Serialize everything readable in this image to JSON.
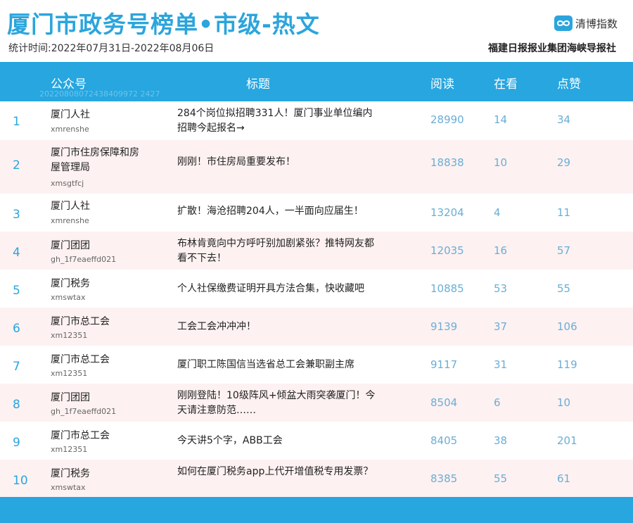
{
  "header": {
    "title": "厦门市政务号榜单•市级-热文",
    "period": "统计时间:2022年07月31日-2022年08月06日",
    "logo_text": "清博指数",
    "publisher": "福建日报报业集团海峡导报社"
  },
  "table": {
    "columns": [
      "公众号",
      "标题",
      "阅读",
      "在看",
      "点赞"
    ],
    "watermark": "20220808072438409972 2427",
    "rows": [
      {
        "rank": "1",
        "account": "厦门人社",
        "account_id": "xmrenshe",
        "title": "284个岗位拟招聘331人！厦门事业单位编内招聘今起报名→",
        "reads": "28990",
        "watching": "14",
        "likes": "34"
      },
      {
        "rank": "2",
        "account": "厦门市住房保障和房屋管理局",
        "account_id": "xmsgtfcj",
        "title": "刚刚！市住房局重要发布！",
        "reads": "18838",
        "watching": "10",
        "likes": "29"
      },
      {
        "rank": "3",
        "account": "厦门人社",
        "account_id": "xmrenshe",
        "title": "扩散！海沧招聘204人，一半面向应届生！",
        "reads": "13204",
        "watching": "4",
        "likes": "11"
      },
      {
        "rank": "4",
        "account": "厦门团团",
        "account_id": "gh_1f7eaeffd021",
        "title": "布林肯竟向中方呼吁别加剧紧张？推特网友都看不下去！",
        "reads": "12035",
        "watching": "16",
        "likes": "57"
      },
      {
        "rank": "5",
        "account": "厦门税务",
        "account_id": "xmswtax",
        "title": "个人社保缴费证明开具方法合集，快收藏吧",
        "reads": "10885",
        "watching": "53",
        "likes": "55"
      },
      {
        "rank": "6",
        "account": "厦门市总工会",
        "account_id": "xm12351",
        "title": "工会工会冲冲冲！",
        "reads": "9139",
        "watching": "37",
        "likes": "106"
      },
      {
        "rank": "7",
        "account": "厦门市总工会",
        "account_id": "xm12351",
        "title": "厦门职工陈国信当选省总工会兼职副主席",
        "reads": "9117",
        "watching": "31",
        "likes": "119"
      },
      {
        "rank": "8",
        "account": "厦门团团",
        "account_id": "gh_1f7eaeffd021",
        "title": "刚刚登陆！10级阵风+倾盆大雨突袭厦门！今天请注意防范……",
        "reads": "8504",
        "watching": "6",
        "likes": "10"
      },
      {
        "rank": "9",
        "account": "厦门市总工会",
        "account_id": "xm12351",
        "title": "今天讲5个字，ABB工会",
        "reads": "8405",
        "watching": "38",
        "likes": "201"
      },
      {
        "rank": "10",
        "account": "厦门税务",
        "account_id": "xmswtax",
        "title": "如何在厦门税务app上代开增值税专用发票？",
        "reads": "8385",
        "watching": "55",
        "likes": "61"
      }
    ]
  }
}
